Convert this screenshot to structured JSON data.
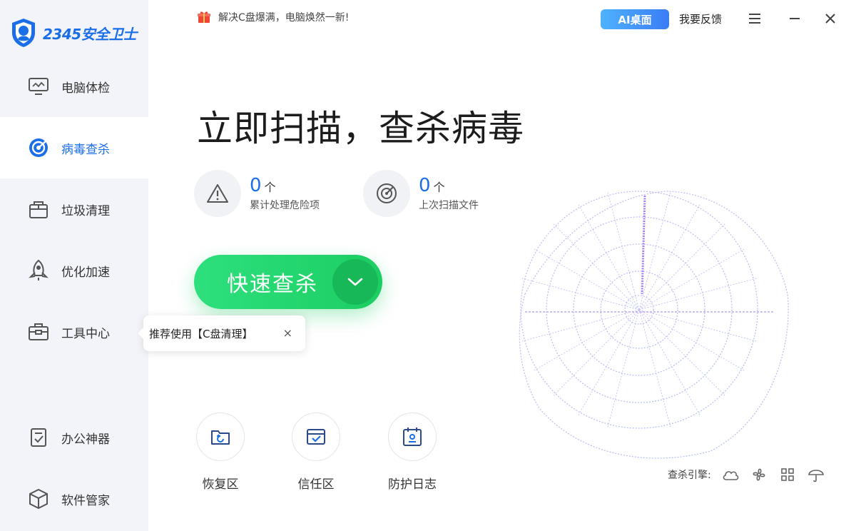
{
  "app": {
    "logo_text": "2345安全卫士",
    "promo_text": "解决C盘爆满，电脑焕然一新!",
    "ai_button": "AI桌面",
    "feedback": "我要反馈"
  },
  "sidebar": {
    "items": [
      {
        "label": "电脑体检",
        "icon": "monitor-icon"
      },
      {
        "label": "病毒查杀",
        "icon": "target-icon",
        "active": true
      },
      {
        "label": "垃圾清理",
        "icon": "trash-bin-icon"
      },
      {
        "label": "优化加速",
        "icon": "rocket-icon"
      },
      {
        "label": "工具中心",
        "icon": "toolbox-icon"
      },
      {
        "label": "办公神器",
        "icon": "document-check-icon"
      },
      {
        "label": "软件管家",
        "icon": "cube-icon"
      }
    ]
  },
  "main": {
    "title": "立即扫描，查杀病毒",
    "stats": [
      {
        "value": "0",
        "unit": "个",
        "label": "累计处理危险项"
      },
      {
        "value": "0",
        "unit": "个",
        "label": "上次扫描文件"
      }
    ],
    "scan_button": "快速查杀",
    "tooltip": {
      "text": "推荐使用【C盘清理】",
      "close": "×"
    },
    "tools": [
      {
        "label": "恢复区",
        "icon": "restore-folder-icon"
      },
      {
        "label": "信任区",
        "icon": "trust-check-icon"
      },
      {
        "label": "防护日志",
        "icon": "calendar-log-icon"
      }
    ],
    "engine_label": "查杀引擎:"
  },
  "colors": {
    "brand_blue": "#1a6ee8",
    "scan_green": "#1ccd62",
    "radar_purple": "#b08cf0"
  }
}
